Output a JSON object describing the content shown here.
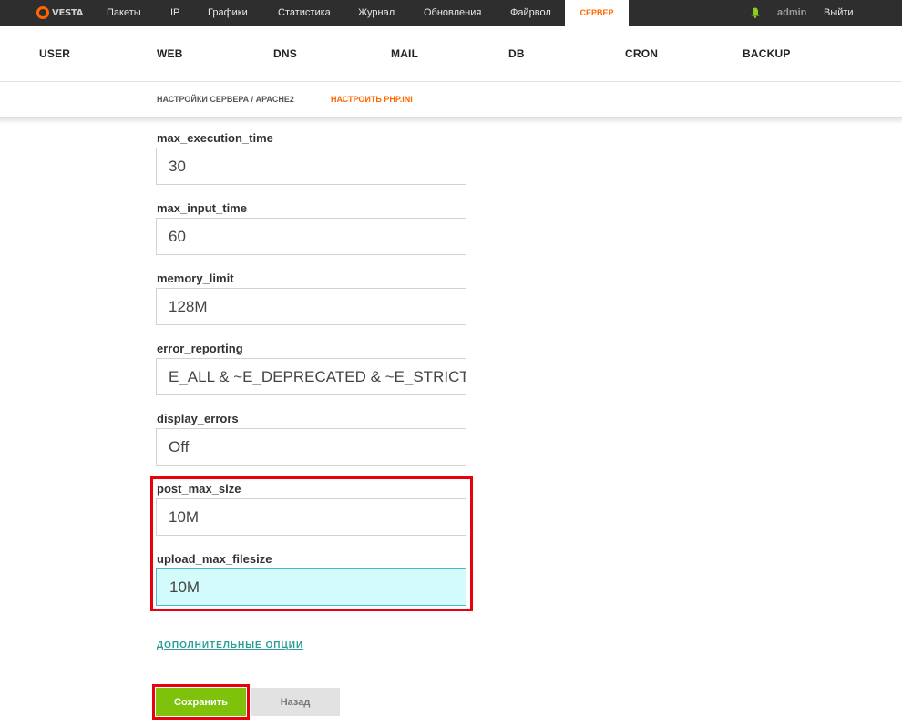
{
  "brand": {
    "logo_text": "VESTA"
  },
  "topbar": {
    "items": [
      {
        "label": "Пакеты"
      },
      {
        "label": "IP"
      },
      {
        "label": "Графики"
      },
      {
        "label": "Статистика"
      },
      {
        "label": "Журнал"
      },
      {
        "label": "Обновления"
      },
      {
        "label": "Файрвол"
      },
      {
        "label": "СЕРВЕР",
        "active": true
      }
    ],
    "user": "admin",
    "logout": "Выйти"
  },
  "mainnav": {
    "items": [
      {
        "label": "USER"
      },
      {
        "label": "WEB"
      },
      {
        "label": "DNS"
      },
      {
        "label": "MAIL"
      },
      {
        "label": "DB"
      },
      {
        "label": "CRON"
      },
      {
        "label": "BACKUP"
      }
    ]
  },
  "breadcrumb": {
    "path": "НАСТРОЙКИ СЕРВЕРА / APACHE2",
    "action": "НАСТРОИТЬ PHP.INI"
  },
  "form": {
    "fields": [
      {
        "label": "max_execution_time",
        "value": "30"
      },
      {
        "label": "max_input_time",
        "value": "60"
      },
      {
        "label": "memory_limit",
        "value": "128M"
      },
      {
        "label": "error_reporting",
        "value": "E_ALL & ~E_DEPRECATED & ~E_STRICT"
      },
      {
        "label": "display_errors",
        "value": "Off"
      },
      {
        "label": "post_max_size",
        "value": "10M"
      },
      {
        "label": "upload_max_filesize",
        "value": "10M"
      }
    ],
    "more_options": "ДОПОЛНИТЕЛЬНЫЕ ОПЦИИ",
    "save": "Сохранить",
    "back": "Назад"
  },
  "colors": {
    "accent": "#ff6600",
    "save_green": "#7ec20c",
    "highlight_red": "#e8000b",
    "focused_input": "#d4fbfc",
    "link_teal": "#2a9d95"
  }
}
